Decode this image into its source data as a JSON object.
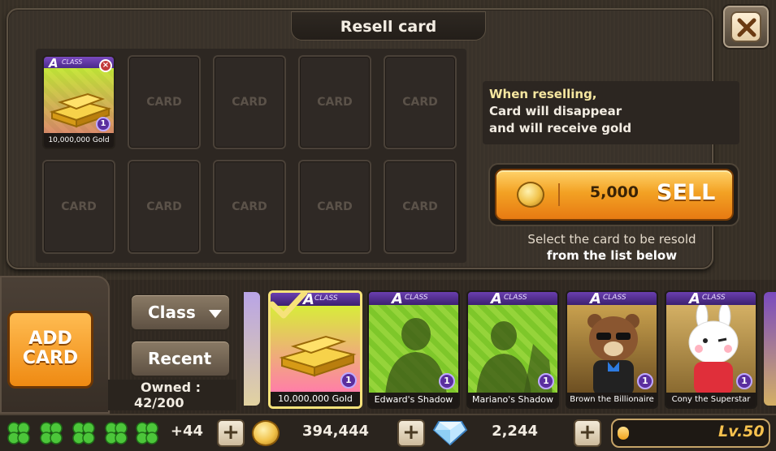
{
  "dialog": {
    "title": "Resell card",
    "close_icon": "close-icon"
  },
  "resell_grid": {
    "slots": [
      {
        "filled": true,
        "card": {
          "class_letter": "A",
          "class_text": "CLASS",
          "level": "1",
          "name": "10,000,000 Gold",
          "art": "gold-bars"
        }
      },
      {
        "filled": false,
        "label": "CARD"
      },
      {
        "filled": false,
        "label": "CARD"
      },
      {
        "filled": false,
        "label": "CARD"
      },
      {
        "filled": false,
        "label": "CARD"
      },
      {
        "filled": false,
        "label": "CARD"
      },
      {
        "filled": false,
        "label": "CARD"
      },
      {
        "filled": false,
        "label": "CARD"
      },
      {
        "filled": false,
        "label": "CARD"
      },
      {
        "filled": false,
        "label": "CARD"
      }
    ]
  },
  "info": {
    "line1": "When reselling,",
    "line2": "Card will disappear",
    "line3": "and will receive gold"
  },
  "sell": {
    "price": "5,000",
    "label": "SELL",
    "coin_icon": "gold-coin-icon"
  },
  "hint": {
    "line1": "Select the card to be resold",
    "line2": "from the list below"
  },
  "left_panel": {
    "add_card_line1": "ADD",
    "add_card_line2": "CARD",
    "sort_class": "Class",
    "sort_recent": "Recent",
    "owned_label": "Owned :",
    "owned_value": "42/200"
  },
  "card_list": [
    {
      "class_letter": "A",
      "class_text": "CLASS",
      "level": "1",
      "name": "10,000,000 Gold",
      "art": "gold-bars",
      "selected": true
    },
    {
      "class_letter": "A",
      "class_text": "CLASS",
      "level": "1",
      "name": "Edward's Shadow",
      "art": "shadow-silhouette",
      "selected": false
    },
    {
      "class_letter": "A",
      "class_text": "CLASS",
      "level": "1",
      "name": "Mariano's Shadow",
      "art": "shadow-silhouette",
      "selected": false
    },
    {
      "class_letter": "A",
      "class_text": "CLASS",
      "level": "1",
      "name": "Brown the Billionaire",
      "art": "brown-bear",
      "selected": false
    },
    {
      "class_letter": "A",
      "class_text": "CLASS",
      "level": "1",
      "name": "Cony the Superstar",
      "art": "cony-rabbit",
      "selected": false
    }
  ],
  "status_bar": {
    "clovers_extra": "+44",
    "gold": "394,444",
    "gems": "2,244",
    "level": "Lv.50",
    "xp_fraction": 0.12
  },
  "colors": {
    "card_class_purple": "#5b2fa8",
    "sell_orange": "#f3a224",
    "selected_outline": "#f6e27a"
  }
}
